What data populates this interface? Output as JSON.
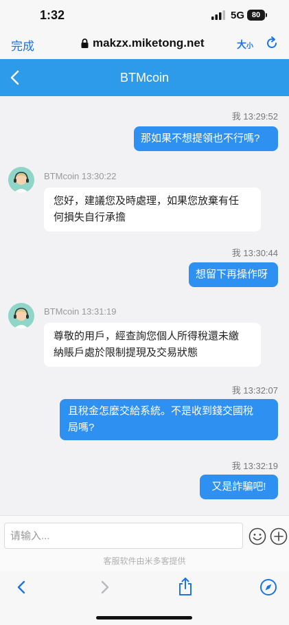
{
  "status_bar": {
    "time": "1:32",
    "network": "5G",
    "battery": "80"
  },
  "browser": {
    "done_label": "完成",
    "url": "makzx.miketong.net",
    "text_size_label": "大",
    "text_size_small": "小"
  },
  "chat": {
    "title": "BTMcoin"
  },
  "messages": [
    {
      "side": "right",
      "meta": "我 13:29:52",
      "text": "那如果不想提領也不行嗎?"
    },
    {
      "side": "left",
      "meta": "BTMcoin 13:30:22",
      "lines": [
        "您好，建議您及時處理，如果您放棄有任",
        "何損失自行承擔"
      ]
    },
    {
      "side": "right",
      "meta": "我 13:30:44",
      "text": "想留下再操作呀"
    },
    {
      "side": "left",
      "meta": "BTMcoin 13:31:19",
      "lines": [
        "尊敬的用戶，經查詢您個人所得稅還未繳",
        "納賬戶處於限制提現及交易狀態"
      ]
    },
    {
      "side": "right",
      "meta": "我 13:32:07",
      "lines": [
        "且稅金怎麼交給系統。不是收到錢交國稅",
        "局嗎?"
      ]
    },
    {
      "side": "right",
      "meta": "我 13:32:19",
      "text": "又是詐騙吧!"
    }
  ],
  "composer": {
    "placeholder": "请输入...",
    "powered_by": "客服软件由米多客提供"
  },
  "colors": {
    "header": "#2e9bea",
    "bubble_right": "#2e90f0",
    "link": "#1a73e8"
  }
}
